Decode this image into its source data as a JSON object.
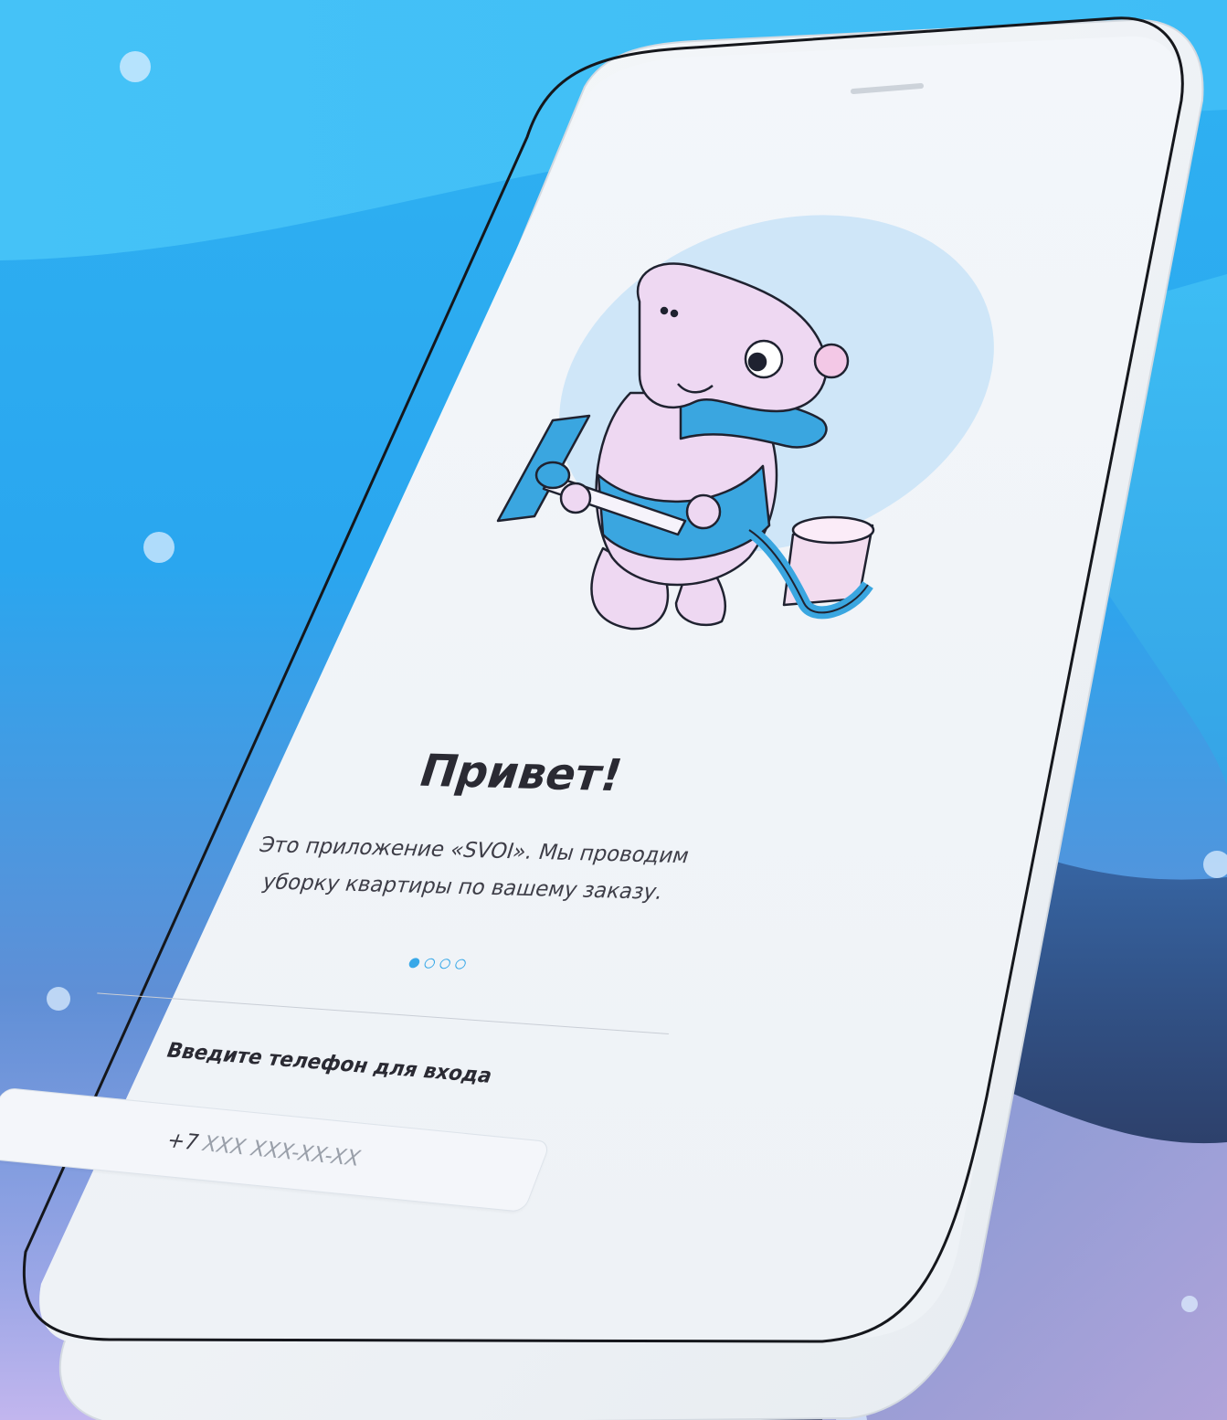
{
  "welcome": {
    "title": "Привет!",
    "description_line1": "Это приложение «SVOI». Мы проводим",
    "description_line2": "уборку квартиры по вашему заказу."
  },
  "pager": {
    "total": 4,
    "active_index": 0
  },
  "login": {
    "label": "Введите телефон для входа",
    "phone_prefix": "+7",
    "phone_placeholder": "XXX XXX-XX-XX"
  },
  "colors": {
    "accent": "#38a8e8",
    "screen_bg": "#f2f5f9",
    "illustration_blob": "#cde6f7",
    "character_body": "#eed8f2",
    "character_outfit": "#3aa6e0"
  },
  "icons": {
    "illustration": "cleaning-character-illustration"
  }
}
